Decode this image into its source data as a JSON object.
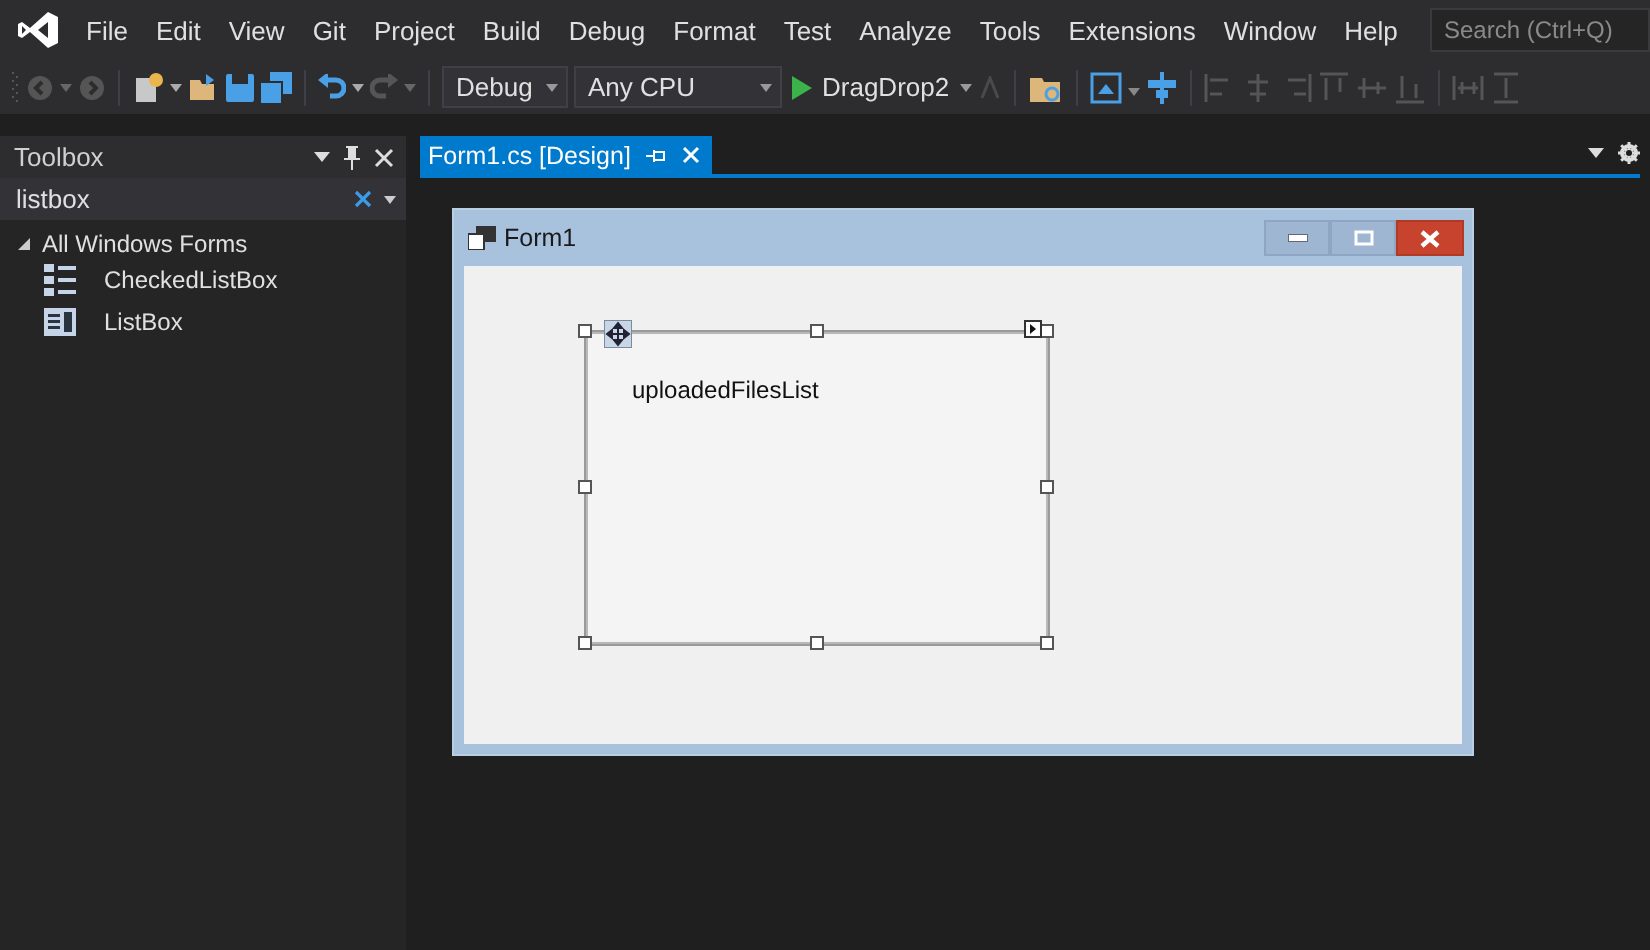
{
  "menu": {
    "items": [
      "File",
      "Edit",
      "View",
      "Git",
      "Project",
      "Build",
      "Debug",
      "Format",
      "Test",
      "Analyze",
      "Tools",
      "Extensions",
      "Window",
      "Help"
    ],
    "search": {
      "placeholder": "Search (Ctrl+Q)"
    }
  },
  "toolbar": {
    "configuration": "Debug",
    "platform": "Any CPU",
    "start_target": "DragDrop2"
  },
  "toolbox": {
    "title": "Toolbox",
    "search": {
      "value": "listbox"
    },
    "groups": [
      {
        "label": "All Windows Forms",
        "expanded": true,
        "children": [
          {
            "label": "CheckedListBox",
            "kind": "checked-list"
          },
          {
            "label": "ListBox",
            "kind": "list"
          }
        ]
      }
    ]
  },
  "tabs": [
    {
      "label": "Form1.cs [Design]",
      "selected": true
    }
  ],
  "form": {
    "title": "Form1",
    "control": {
      "name": "uploadedFilesList",
      "selected": true
    }
  }
}
